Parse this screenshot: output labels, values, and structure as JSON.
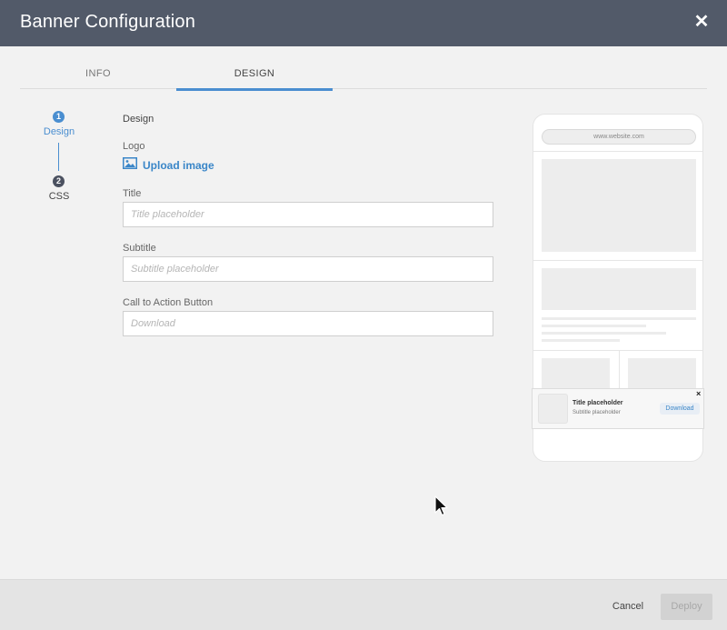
{
  "window": {
    "title": "Banner Configuration"
  },
  "tabs": [
    {
      "label": "INFO",
      "active": false
    },
    {
      "label": "DESIGN",
      "active": true
    }
  ],
  "steps": [
    {
      "number": "1",
      "label": "Design",
      "active": true
    },
    {
      "number": "2",
      "label": "CSS",
      "active": false
    }
  ],
  "form": {
    "section_title": "Design",
    "logo_label": "Logo",
    "upload_label": "Upload image",
    "title_label": "Title",
    "title_placeholder": "Title placeholder",
    "subtitle_label": "Subtitle",
    "subtitle_placeholder": "Subtitle placeholder",
    "cta_label": "Call to Action Button",
    "cta_placeholder": "Download"
  },
  "preview": {
    "url": "www.website.com",
    "banner_title": "Title placeholder",
    "banner_subtitle": "Subtitle placeholder",
    "banner_button": "Download"
  },
  "footer": {
    "cancel_label": "Cancel",
    "deploy_label": "Deploy",
    "deploy_enabled": false
  },
  "colors": {
    "header_bg": "#525a69",
    "accent": "#4a8ed0"
  }
}
